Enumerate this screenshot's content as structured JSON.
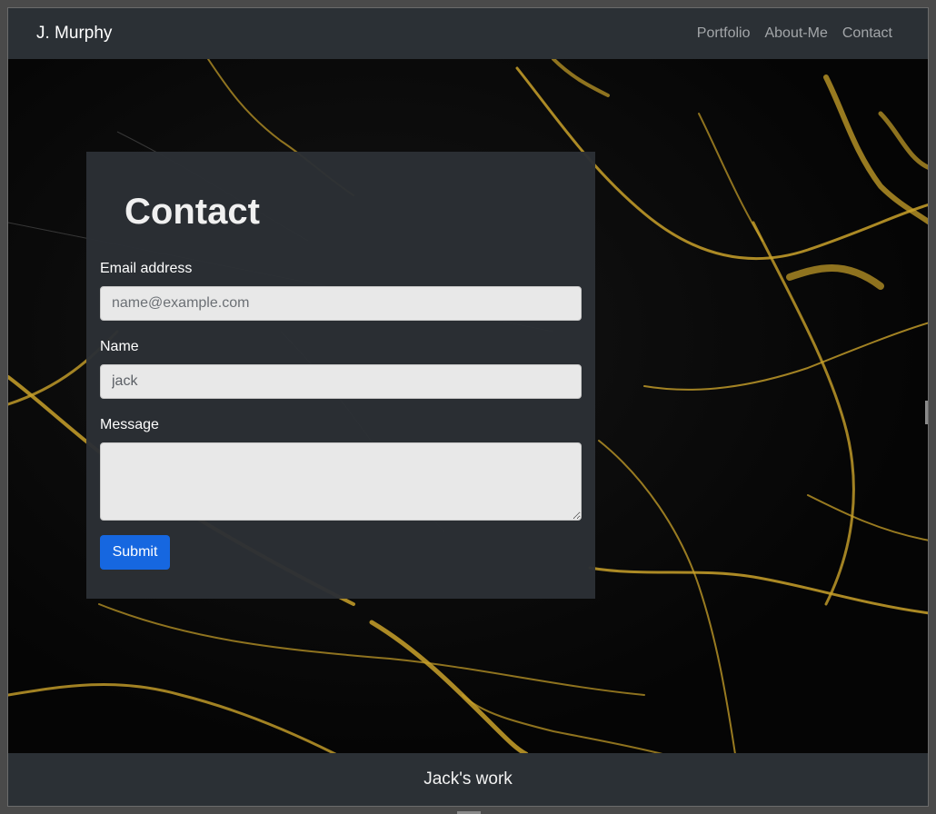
{
  "navbar": {
    "brand": "J. Murphy",
    "links": [
      "Portfolio",
      "About-Me",
      "Contact"
    ]
  },
  "form": {
    "title": "Contact",
    "email_label": "Email address",
    "email_placeholder": "name@example.com",
    "email_value": "",
    "name_label": "Name",
    "name_value": "jack",
    "message_label": "Message",
    "message_value": "",
    "submit_label": "Submit"
  },
  "footer": {
    "text": "Jack's work"
  },
  "colors": {
    "navbar_bg": "#2b3035",
    "card_bg": "#2b3035",
    "submit_bg": "#1667e0",
    "gold_vein": "#c9a12a",
    "marble_bg": "#050505"
  }
}
